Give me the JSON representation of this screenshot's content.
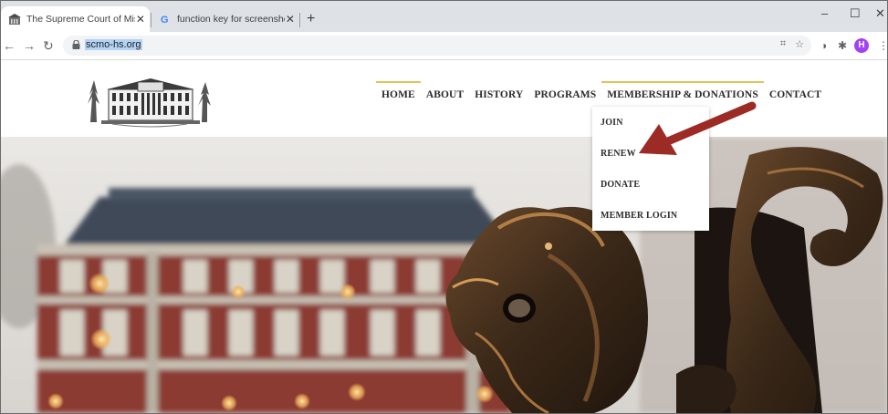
{
  "browser": {
    "tabs": [
      {
        "title": "The Supreme Court of Missouri H",
        "active": true
      },
      {
        "title": "function key for screenshot - Goo",
        "active": false
      }
    ],
    "new_tab_symbol": "+",
    "close_symbol": "✕",
    "url": "scmo-hs.org",
    "profile_initial": "H",
    "window_controls": {
      "minimize": "–",
      "maximize": "☐",
      "close": "✕"
    }
  },
  "site": {
    "nav": [
      "HOME",
      "ABOUT",
      "HISTORY",
      "PROGRAMS",
      "MEMBERSHIP & DONATIONS",
      "CONTACT"
    ],
    "dropdown": [
      "JOIN",
      "RENEW",
      "DONATE",
      "MEMBER LOGIN"
    ]
  },
  "colors": {
    "accent_line": "#e5c15a",
    "arrow": "#9c2b25",
    "profile": "#a142f4"
  }
}
